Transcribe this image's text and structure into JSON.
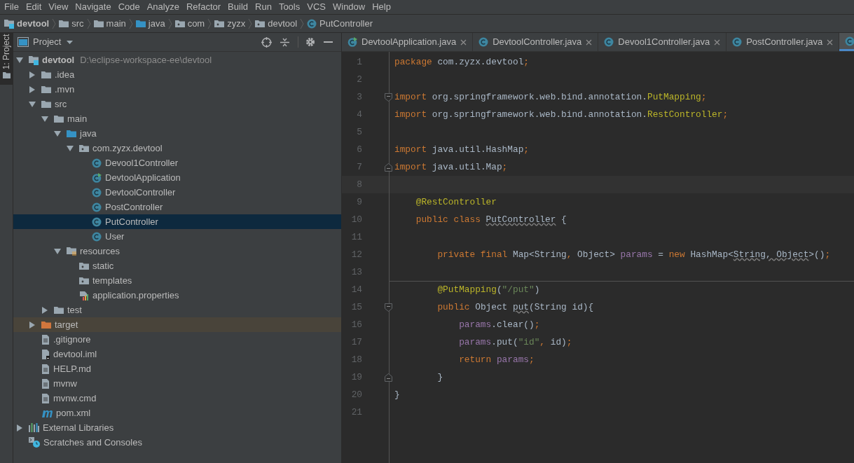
{
  "menu_bar": [
    {
      "label": "File"
    },
    {
      "label": "Edit"
    },
    {
      "label": "View"
    },
    {
      "label": "Navigate"
    },
    {
      "label": "Code"
    },
    {
      "label": "Analyze"
    },
    {
      "label": "Refactor"
    },
    {
      "label": "Build"
    },
    {
      "label": "Run"
    },
    {
      "label": "Tools"
    },
    {
      "label": "VCS"
    },
    {
      "label": "Window"
    },
    {
      "label": "Help"
    }
  ],
  "breadcrumbs": [
    {
      "kind": "module",
      "label": "devtool"
    },
    {
      "kind": "folder",
      "label": "src"
    },
    {
      "kind": "folder",
      "label": "main"
    },
    {
      "kind": "source-folder",
      "label": "java"
    },
    {
      "kind": "package",
      "label": "com"
    },
    {
      "kind": "package",
      "label": "zyzx"
    },
    {
      "kind": "package",
      "label": "devtool"
    },
    {
      "kind": "class",
      "label": "PutController"
    }
  ],
  "side_stripe": {
    "label": "1: Project"
  },
  "project_panel": {
    "title": "Project",
    "tree": [
      {
        "kind": "module",
        "label": "devtool",
        "path": "D:\\eclipse-workspace-ee\\devtool",
        "expanded": true,
        "selected": false,
        "children": [
          {
            "kind": "folder",
            "label": ".idea",
            "expanded": false,
            "selected": false
          },
          {
            "kind": "folder",
            "label": ".mvn",
            "expanded": false,
            "selected": false
          },
          {
            "kind": "folder",
            "label": "src",
            "expanded": true,
            "selected": false,
            "children": [
              {
                "kind": "folder",
                "label": "main",
                "expanded": true,
                "selected": false,
                "children": [
                  {
                    "kind": "source-folder",
                    "label": "java",
                    "expanded": true,
                    "selected": false,
                    "children": [
                      {
                        "kind": "package",
                        "label": "com.zyzx.devtool",
                        "expanded": true,
                        "selected": false,
                        "children": [
                          {
                            "kind": "class",
                            "label": "Devool1Controller",
                            "selected": false
                          },
                          {
                            "kind": "app-class",
                            "label": "DevtoolApplication",
                            "selected": false
                          },
                          {
                            "kind": "class",
                            "label": "DevtoolController",
                            "selected": false
                          },
                          {
                            "kind": "class",
                            "label": "PostController",
                            "selected": false
                          },
                          {
                            "kind": "class",
                            "label": "PutController",
                            "selected": true
                          },
                          {
                            "kind": "class",
                            "label": "User",
                            "selected": false
                          }
                        ]
                      }
                    ]
                  },
                  {
                    "kind": "resource-folder",
                    "label": "resources",
                    "expanded": true,
                    "selected": false,
                    "children": [
                      {
                        "kind": "package",
                        "label": "static",
                        "selected": false
                      },
                      {
                        "kind": "package",
                        "label": "templates",
                        "selected": false
                      },
                      {
                        "kind": "properties",
                        "label": "application.properties",
                        "selected": false
                      }
                    ]
                  }
                ]
              },
              {
                "kind": "folder",
                "label": "test",
                "expanded": false,
                "selected": false
              }
            ]
          },
          {
            "kind": "excluded-folder",
            "label": "target",
            "expanded": false,
            "selected": false
          },
          {
            "kind": "file",
            "label": ".gitignore",
            "selected": false
          },
          {
            "kind": "iml",
            "label": "devtool.iml",
            "selected": false
          },
          {
            "kind": "file",
            "label": "HELP.md",
            "selected": false
          },
          {
            "kind": "file",
            "label": "mvnw",
            "selected": false
          },
          {
            "kind": "file",
            "label": "mvnw.cmd",
            "selected": false
          },
          {
            "kind": "maven",
            "label": "pom.xml",
            "selected": false
          }
        ]
      },
      {
        "kind": "libraries",
        "label": "External Libraries",
        "expanded": false,
        "selected": false
      },
      {
        "kind": "scratches",
        "label": "Scratches and Consoles",
        "selected": false
      }
    ]
  },
  "editor_tabs": [
    {
      "kind": "app-class",
      "label": "DevtoolApplication.java",
      "selected": false
    },
    {
      "kind": "class",
      "label": "DevtoolController.java",
      "selected": false
    },
    {
      "kind": "class",
      "label": "Devool1Controller.java",
      "selected": false
    },
    {
      "kind": "class",
      "label": "PostController.java",
      "selected": false
    },
    {
      "kind": "class",
      "selected": true
    }
  ],
  "code_lines": [
    {
      "number": "1",
      "tokens": [
        {
          "kind": "keyword",
          "text": "package "
        },
        {
          "kind": "plain",
          "text": "com.zyzx.devtool"
        },
        {
          "kind": "keyword",
          "text": ";"
        }
      ]
    },
    {
      "number": "2"
    },
    {
      "number": "3",
      "fold_start": true,
      "tokens": [
        {
          "kind": "keyword",
          "text": "import "
        },
        {
          "kind": "plain",
          "text": "org.springframework.web.bind.annotation."
        },
        {
          "kind": "annotation",
          "text": "PutMapping"
        },
        {
          "kind": "keyword",
          "text": ";"
        }
      ]
    },
    {
      "number": "4",
      "tokens": [
        {
          "kind": "keyword",
          "text": "import "
        },
        {
          "kind": "plain",
          "text": "org.springframework.web.bind.annotation."
        },
        {
          "kind": "annotation",
          "text": "RestController"
        },
        {
          "kind": "keyword",
          "text": ";"
        }
      ]
    },
    {
      "number": "5"
    },
    {
      "number": "6",
      "tokens": [
        {
          "kind": "keyword",
          "text": "import "
        },
        {
          "kind": "plain",
          "text": "java.util.HashMap"
        },
        {
          "kind": "keyword",
          "text": ";"
        }
      ]
    },
    {
      "number": "7",
      "fold_end": true,
      "tokens": [
        {
          "kind": "keyword",
          "text": "import "
        },
        {
          "kind": "plain",
          "text": "java.util.Map"
        },
        {
          "kind": "keyword",
          "text": ";"
        }
      ]
    },
    {
      "number": "8",
      "current": true
    },
    {
      "number": "9",
      "tokens": [
        {
          "kind": "annotation",
          "text": "    @RestController"
        }
      ]
    },
    {
      "number": "10",
      "tokens": [
        {
          "kind": "keyword",
          "text": "    public class "
        },
        {
          "kind": "typo",
          "text": "PutController"
        },
        {
          "kind": "plain",
          "text": " {"
        }
      ]
    },
    {
      "number": "11"
    },
    {
      "number": "12",
      "tokens": [
        {
          "kind": "keyword",
          "text": "        private final "
        },
        {
          "kind": "plain",
          "text": "Map<String"
        },
        {
          "kind": "keyword",
          "text": ", "
        },
        {
          "kind": "plain",
          "text": "Object> "
        },
        {
          "kind": "field",
          "text": "params"
        },
        {
          "kind": "plain",
          "text": " = "
        },
        {
          "kind": "keyword",
          "text": "new "
        },
        {
          "kind": "plain",
          "text": "HashMap<"
        },
        {
          "kind": "typo",
          "text": "String, Object"
        },
        {
          "kind": "plain",
          "text": ">()"
        },
        {
          "kind": "keyword",
          "text": ";"
        }
      ]
    },
    {
      "number": "13"
    },
    {
      "number": "14",
      "separator": true,
      "tokens": [
        {
          "kind": "annotation",
          "text": "        @PutMapping"
        },
        {
          "kind": "plain",
          "text": "("
        },
        {
          "kind": "string",
          "text": "\"/put\""
        },
        {
          "kind": "plain",
          "text": ")"
        }
      ]
    },
    {
      "number": "15",
      "fold_start": true,
      "tokens": [
        {
          "kind": "keyword",
          "text": "        public "
        },
        {
          "kind": "plain",
          "text": "Object "
        },
        {
          "kind": "typo",
          "text": "put"
        },
        {
          "kind": "plain",
          "text": "(String id){"
        }
      ]
    },
    {
      "number": "16",
      "tokens": [
        {
          "kind": "field",
          "text": "            params"
        },
        {
          "kind": "plain",
          "text": ".clear()"
        },
        {
          "kind": "keyword",
          "text": ";"
        }
      ]
    },
    {
      "number": "17",
      "tokens": [
        {
          "kind": "field",
          "text": "            params"
        },
        {
          "kind": "plain",
          "text": ".put("
        },
        {
          "kind": "string",
          "text": "\"id\""
        },
        {
          "kind": "keyword",
          "text": ", "
        },
        {
          "kind": "plain",
          "text": "id)"
        },
        {
          "kind": "keyword",
          "text": ";"
        }
      ]
    },
    {
      "number": "18",
      "tokens": [
        {
          "kind": "keyword",
          "text": "            return "
        },
        {
          "kind": "field",
          "text": "params"
        },
        {
          "kind": "keyword",
          "text": ";"
        }
      ]
    },
    {
      "number": "19",
      "fold_end": true,
      "tokens": [
        {
          "kind": "plain",
          "text": "        }"
        }
      ]
    },
    {
      "number": "20",
      "tokens": [
        {
          "kind": "plain",
          "text": "}"
        }
      ]
    },
    {
      "number": "21"
    }
  ]
}
